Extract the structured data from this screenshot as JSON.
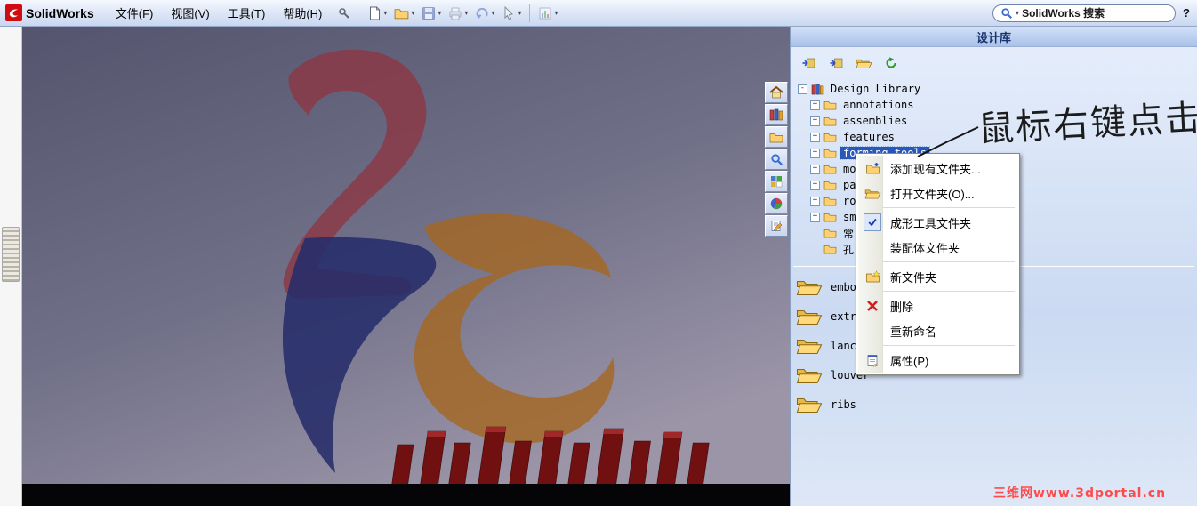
{
  "menubar": {
    "app_name": "SolidWorks",
    "menus": [
      "文件(F)",
      "视图(V)",
      "工具(T)",
      "帮助(H)"
    ],
    "search": {
      "value": "SolidWorks 搜索"
    },
    "help_label": "?"
  },
  "icons": {
    "toolbar": [
      "new-document-icon",
      "open-icon",
      "save-icon",
      "print-icon",
      "undo-icon",
      "select-cursor-icon",
      "chart-icon"
    ],
    "taskpane_tabs": [
      "home-icon",
      "design-library-icon",
      "file-explorer-icon",
      "search-icon",
      "view-palette-icon",
      "appearances-icon",
      "custom-properties-icon"
    ],
    "taskpane_toolbar": [
      "add-to-library-icon",
      "add-file-to-library-icon",
      "open-folder-icon",
      "refresh-icon"
    ]
  },
  "taskpane": {
    "title": "设计库",
    "tree": {
      "items": [
        {
          "label": "Design Library",
          "expander": "-",
          "selected": false
        },
        {
          "label": "annotations",
          "expander": "+",
          "selected": false
        },
        {
          "label": "assemblies",
          "expander": "+",
          "selected": false
        },
        {
          "label": "features",
          "expander": "+",
          "selected": false
        },
        {
          "label": "forming tools",
          "expander": "+",
          "selected": true
        },
        {
          "label": "mo",
          "expander": "+",
          "selected": false
        },
        {
          "label": "pa",
          "expander": "+",
          "selected": false
        },
        {
          "label": "ro",
          "expander": "+",
          "selected": false
        },
        {
          "label": "sm",
          "expander": "+",
          "selected": false
        },
        {
          "label": "常",
          "expander": "",
          "selected": false
        },
        {
          "label": "孔",
          "expander": "",
          "selected": false
        }
      ]
    },
    "folders": [
      {
        "label": "emboss"
      },
      {
        "label": "extrud"
      },
      {
        "label": "lances"
      },
      {
        "label": "louver"
      },
      {
        "label": "ribs"
      }
    ]
  },
  "context_menu": {
    "items": [
      {
        "label": "添加现有文件夹...",
        "icon": "add-existing-folder-icon",
        "checked": false
      },
      {
        "label": "打开文件夹(O)...",
        "icon": "open-folder-icon",
        "checked": false
      },
      {
        "label": "成形工具文件夹",
        "icon": "checkmark-icon",
        "checked": true
      },
      {
        "label": "装配体文件夹",
        "icon": "",
        "checked": false
      },
      {
        "label": "新文件夹",
        "icon": "new-folder-icon",
        "checked": false
      },
      {
        "label": "删除",
        "icon": "delete-x-icon",
        "checked": false
      },
      {
        "label": "重新命名",
        "icon": "",
        "checked": false
      },
      {
        "label": "属性(P)",
        "icon": "properties-icon",
        "checked": false
      }
    ]
  },
  "annotation": {
    "handwriting": "鼠标右键点击"
  },
  "watermark": {
    "text": "三维网www.3dportal.cn"
  }
}
